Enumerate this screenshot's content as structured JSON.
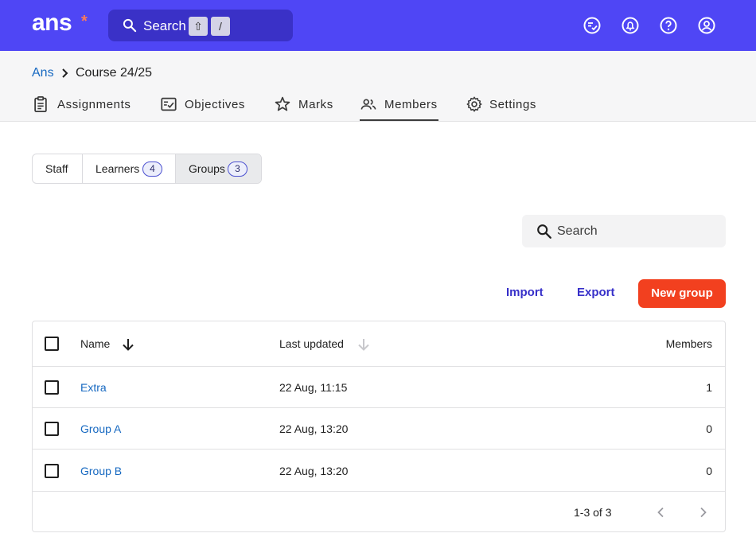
{
  "app": {
    "logo_text": "ans",
    "logo_star": "*"
  },
  "colors": {
    "topbar": "#4f46f5",
    "link": "#1769c1",
    "primary": "#f2401f",
    "action_link": "#3730c9"
  },
  "global_search": {
    "label": "Search",
    "shortcut_keys": [
      "⇧",
      "/"
    ]
  },
  "top_icons": [
    "checklist-icon",
    "bell-icon",
    "help-icon",
    "account-icon"
  ],
  "breadcrumb": {
    "root": "Ans",
    "current": "Course 24/25"
  },
  "nav_tabs": [
    {
      "label": "Assignments",
      "icon": "clipboard-icon",
      "active": false
    },
    {
      "label": "Objectives",
      "icon": "objectives-icon",
      "active": false
    },
    {
      "label": "Marks",
      "icon": "star-icon",
      "active": false
    },
    {
      "label": "Members",
      "icon": "people-icon",
      "active": true
    },
    {
      "label": "Settings",
      "icon": "gear-icon",
      "active": false
    }
  ],
  "segments": [
    {
      "label": "Staff"
    },
    {
      "label": "Learners",
      "count": "4"
    },
    {
      "label": "Groups",
      "count": "3",
      "selected": true
    }
  ],
  "search": {
    "placeholder": "Search",
    "value": ""
  },
  "actions": {
    "import": "Import",
    "export": "Export",
    "new_group": "New group"
  },
  "table": {
    "columns": {
      "name": "Name",
      "last_updated": "Last updated",
      "members": "Members"
    },
    "rows": [
      {
        "name": "Extra",
        "last_updated": "22 Aug, 11:15",
        "members": "1"
      },
      {
        "name": "Group A",
        "last_updated": "22 Aug, 13:20",
        "members": "0"
      },
      {
        "name": "Group B",
        "last_updated": "22 Aug, 13:20",
        "members": "0"
      }
    ],
    "pagination": "1-3 of 3"
  }
}
